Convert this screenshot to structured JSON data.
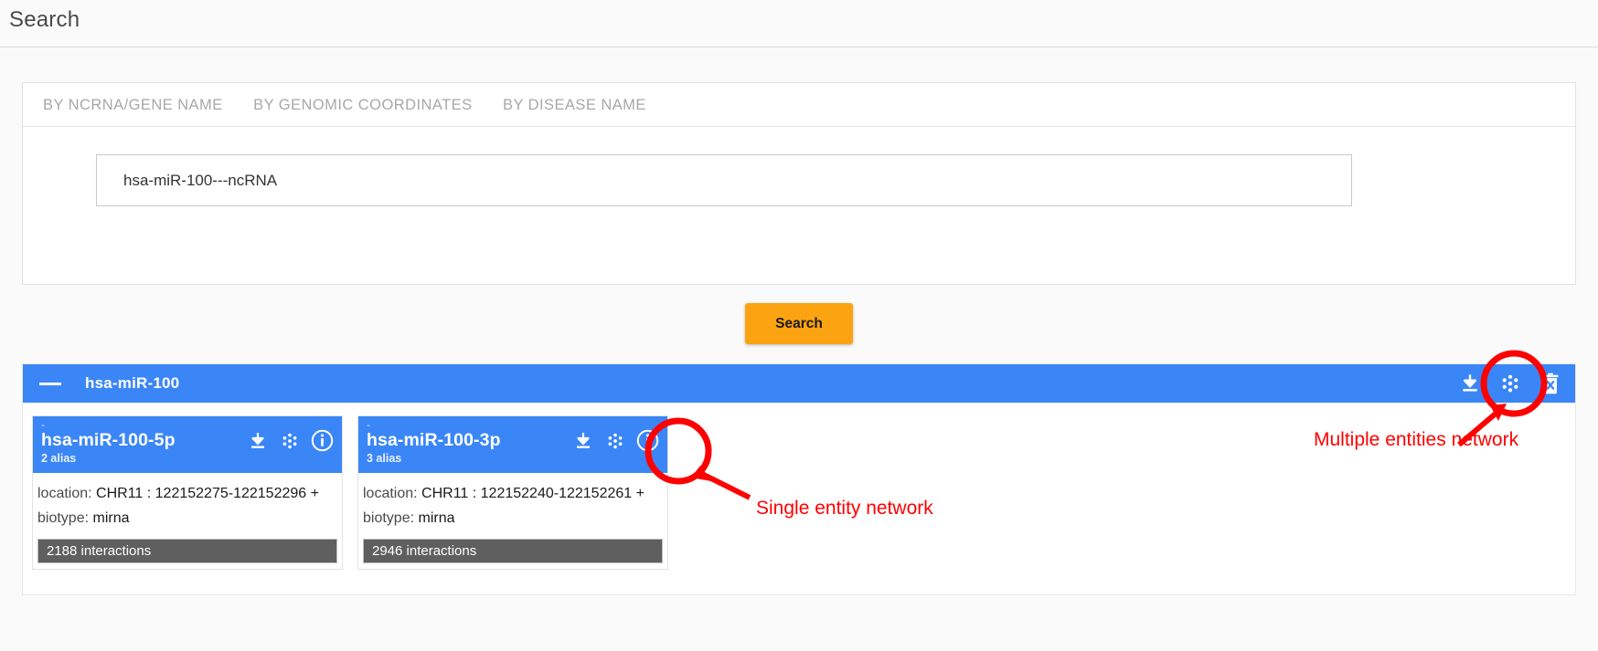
{
  "header": {
    "title": "Search"
  },
  "search_panel": {
    "tabs": [
      {
        "label": "BY NCRNA/GENE NAME",
        "name": "tab-by-ncrna-gene-name",
        "active": true
      },
      {
        "label": "BY GENOMIC COORDINATES",
        "name": "tab-by-genomic-coordinates",
        "active": false
      },
      {
        "label": "BY DISEASE NAME",
        "name": "tab-by-disease-name",
        "active": false
      }
    ],
    "input": {
      "value": "hsa-miR-100---ncRNA",
      "placeholder": ""
    },
    "search_button_label": "Search"
  },
  "results": {
    "group": {
      "title": "hsa-miR-100",
      "collapse_icon": "minus-icon",
      "actions": [
        {
          "name": "download-icon",
          "label": "download"
        },
        {
          "name": "network-icon",
          "label": "multiple entities network"
        },
        {
          "name": "delete-icon",
          "label": "delete"
        }
      ]
    },
    "cards": [
      {
        "dash": "-",
        "name": "hsa-miR-100-5p",
        "alias": "2 alias",
        "location_label": "location:",
        "location_value": "CHR11 : 122152275-122152296 +",
        "biotype_label": "biotype:",
        "biotype_value": "mirna",
        "interactions": "2188 interactions",
        "icons": [
          {
            "name": "download-icon"
          },
          {
            "name": "network-icon"
          },
          {
            "name": "info-icon"
          }
        ]
      },
      {
        "dash": "-",
        "name": "hsa-miR-100-3p",
        "alias": "3 alias",
        "location_label": "location:",
        "location_value": "CHR11 : 122152240-122152261 +",
        "biotype_label": "biotype:",
        "biotype_value": "mirna",
        "interactions": "2946 interactions",
        "icons": [
          {
            "name": "download-icon"
          },
          {
            "name": "network-icon"
          },
          {
            "name": "info-icon"
          }
        ]
      }
    ]
  },
  "annotations": [
    {
      "name": "annotation-single-entity-network",
      "text": "Single entity network"
    },
    {
      "name": "annotation-multiple-entities-network",
      "text": "Multiple entities network"
    }
  ],
  "colors": {
    "accent_blue": "#3B86F7",
    "accent_orange": "#FCA311",
    "annotation_red": "#FF0000",
    "footer_gray": "#5f5f5f",
    "page_bg": "#fafafa"
  }
}
